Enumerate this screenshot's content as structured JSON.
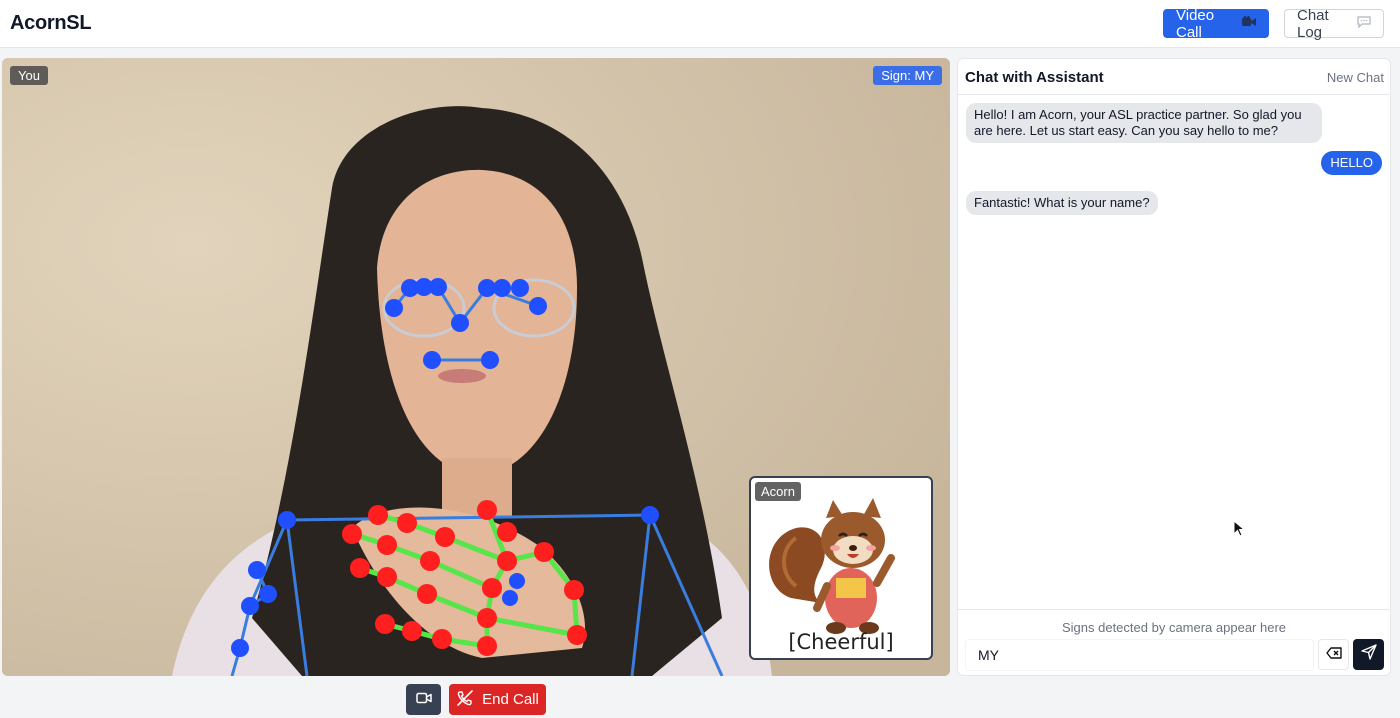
{
  "app": {
    "title": "AcornSL"
  },
  "nav": {
    "video_call_label": "Video Call",
    "video_call_icon": "video-camera-icon",
    "chat_log_label": "Chat Log",
    "chat_log_icon": "speech-bubble-icon"
  },
  "video": {
    "self_tag": "You",
    "detected_sign_tag": "Sign: MY",
    "landmark_colors": {
      "face_pose": "#1f4fff",
      "hand_points": "#ff1f1f",
      "hand_links": "#57e64a",
      "pose_links": "#3a7de0"
    }
  },
  "avatar": {
    "name_tag": "Acorn",
    "mood": "[Cheerful]"
  },
  "call_controls": {
    "camera_icon": "video-camera-icon",
    "end_call_label": "End Call",
    "end_call_icon": "phone-off-icon"
  },
  "chat": {
    "title": "Chat with Assistant",
    "new_chat_label": "New Chat",
    "messages": [
      {
        "role": "assistant",
        "text": "Hello! I am Acorn, your ASL practice partner. So glad you are here. Let us start easy. Can you say hello to me?"
      },
      {
        "role": "user",
        "text": "HELLO"
      },
      {
        "role": "assistant",
        "text": "Fantastic! What is your name?"
      }
    ],
    "hint": "Signs detected by camera appear here",
    "input_value": "MY",
    "clear_icon": "backspace-icon",
    "send_icon": "send-icon"
  },
  "colors": {
    "primary": "#2563eb",
    "danger": "#dc2626",
    "dark": "#111827"
  }
}
